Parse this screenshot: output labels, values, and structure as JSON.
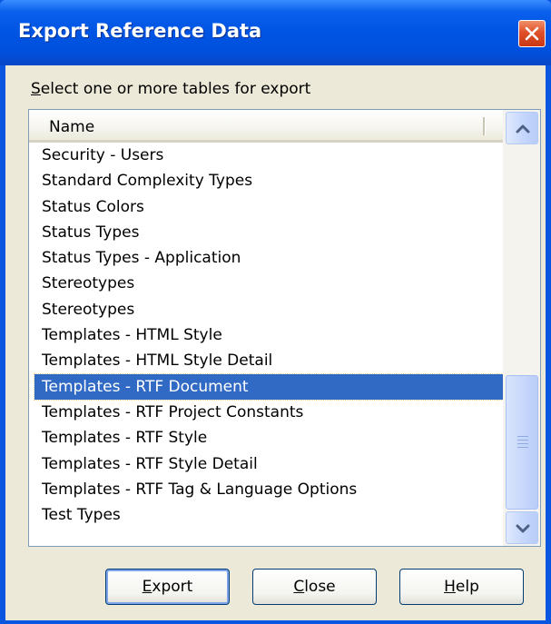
{
  "window": {
    "title": "Export Reference Data"
  },
  "prompt": {
    "mnemonic": "S",
    "rest": "elect one or more tables for export"
  },
  "list": {
    "column_header": "Name",
    "selected_index": 9,
    "items": [
      "Security - Users",
      "Standard Complexity Types",
      "Status Colors",
      "Status Types",
      "Status Types - Application",
      "Stereotypes",
      "Stereotypes",
      "Templates - HTML Style",
      "Templates - HTML Style Detail",
      "Templates - RTF Document",
      "Templates - RTF Project Constants",
      "Templates - RTF Style",
      "Templates - RTF Style Detail",
      "Templates - RTF Tag & Language Options",
      "Test Types"
    ]
  },
  "buttons": {
    "export": {
      "mnemonic": "E",
      "rest": "xport"
    },
    "close": {
      "mnemonic": "C",
      "rest": "lose"
    },
    "help": {
      "mnemonic": "H",
      "rest": "elp"
    }
  },
  "colors": {
    "title_bar": "#0054e3",
    "dialog_face": "#ece9d8",
    "selection": "#316ac5",
    "close_button": "#e0502a"
  },
  "icons": {
    "close": "close-x-icon",
    "scroll_up": "chevron-up-icon",
    "scroll_down": "chevron-down-icon"
  }
}
